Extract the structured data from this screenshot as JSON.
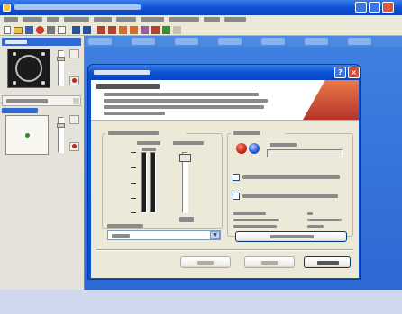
{
  "app": {
    "title": "",
    "menu": [],
    "ruler": [],
    "track1": {
      "name": ""
    },
    "track2": {
      "name": "",
      "button": ""
    }
  },
  "dialog": {
    "title": "",
    "heading": "",
    "description": "",
    "input_group": {
      "title": "",
      "meter_label": "",
      "level_label": "",
      "scale": [],
      "level_percent": 100,
      "source_label": "",
      "source_value": ""
    },
    "navigation": {
      "title": "",
      "position_label": "",
      "stop_on_signal": "",
      "stop_after_silence": "",
      "disk_free_label": "",
      "disk_free_value": "",
      "file_name_label": "",
      "file_name_value": "",
      "max_time_label": "",
      "max_time_value": "",
      "change_file_button": ""
    },
    "buttons": {
      "back": "",
      "next": "",
      "cancel": ""
    }
  },
  "colors": {
    "titlebar": "#0a4fd4",
    "dialog_bg": "#ece9d8",
    "close_button": "#e0473a",
    "record_button": "#d0281c",
    "play_button": "#2a5cd6"
  }
}
